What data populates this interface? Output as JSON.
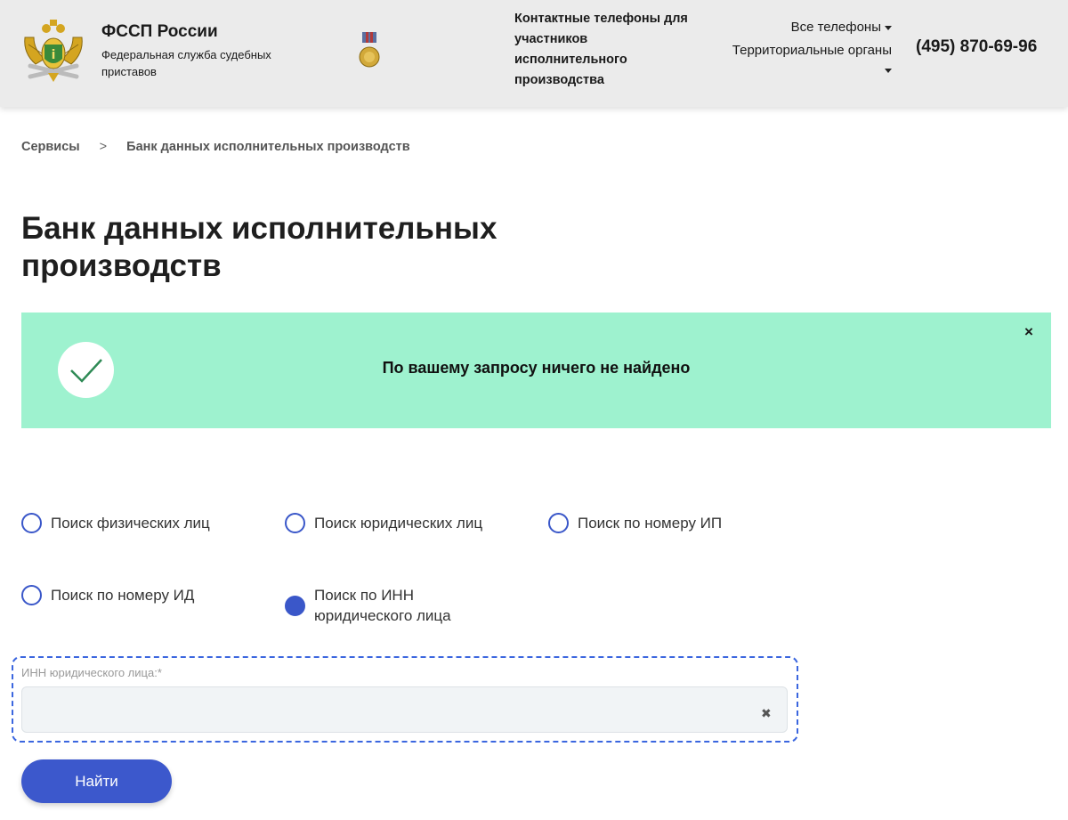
{
  "header": {
    "org_name": "ФССП России",
    "org_full_name": "Федеральная служба судебных приставов",
    "contacts_title": "Контактные телефоны для участников исполнительного производства",
    "links": [
      {
        "label": "Все телефоны"
      },
      {
        "label": "Территориальные органы"
      }
    ],
    "phone": "(495) 870-69-96",
    "emblem_icon": "fssp-emblem-icon",
    "medal_icon": "medal-icon"
  },
  "breadcrumb": {
    "items": [
      "Сервисы",
      "Банк данных исполнительных производств"
    ],
    "separator": ">"
  },
  "page_title": "Банк данных исполнительных производств",
  "notice": {
    "text": "По вашему запросу ничего не найдено",
    "close": "×",
    "background": "#9ef2cf",
    "icon": "check-icon"
  },
  "search_types": [
    {
      "label": "Поиск физических лиц",
      "selected": false
    },
    {
      "label": "Поиск юридических лиц",
      "selected": false
    },
    {
      "label": "Поиск по номеру ИП",
      "selected": false
    },
    {
      "label": "Поиск по номеру ИД",
      "selected": false
    },
    {
      "label": "Поиск по ИНН юридического лица",
      "selected": true
    }
  ],
  "inn_field": {
    "label": "ИНН юридического лица:*",
    "value": "",
    "clear": "✖"
  },
  "submit_label": "Найти",
  "colors": {
    "accent": "#3c58cc",
    "notice_green": "#9ef2cf",
    "header_bg": "#ebebeb"
  }
}
